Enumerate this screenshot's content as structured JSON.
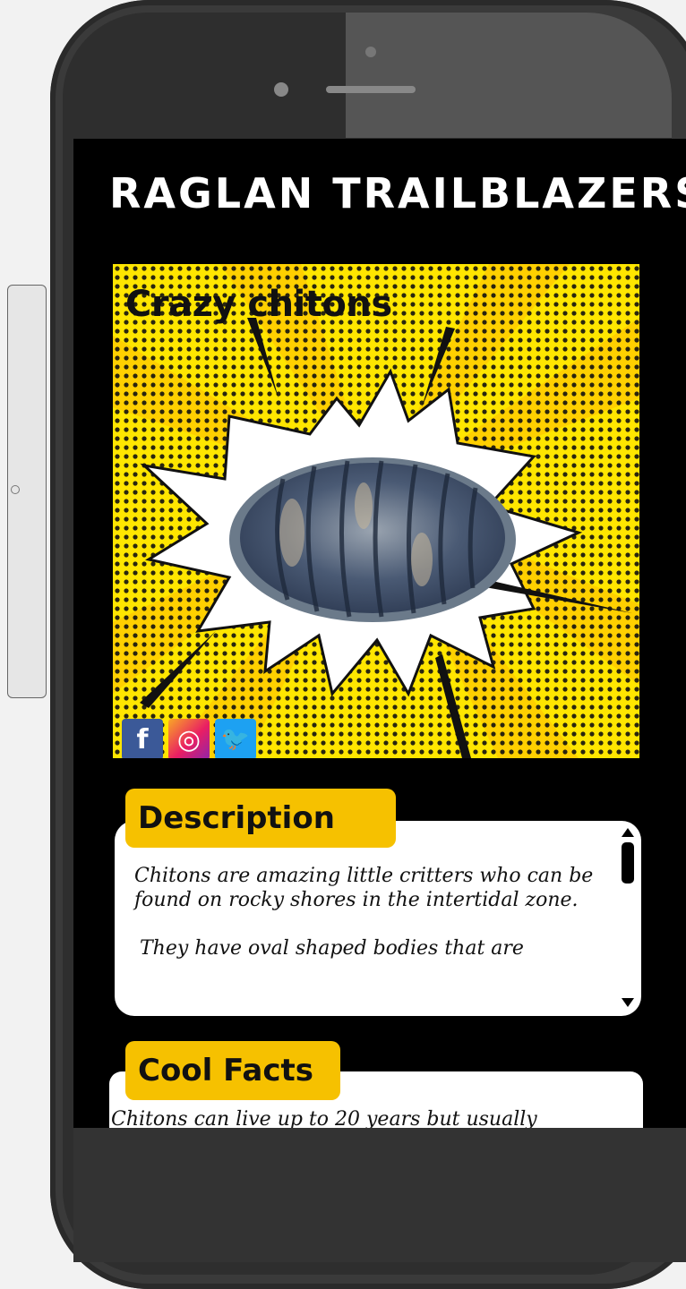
{
  "app": {
    "title": "RAGLAN TRAILBLAZERS"
  },
  "hero": {
    "title": "Crazy chitons",
    "social": {
      "facebook": "f",
      "instagram": "◎",
      "twitter": "🐦"
    }
  },
  "description": {
    "heading": "Description",
    "paragraphs": [
      "Chitons are amazing little critters who can be found on rocky shores in the intertidal zone.",
      "They have oval shaped bodies that are"
    ]
  },
  "facts": {
    "heading": "Cool Facts",
    "text": "Chitons can live up to 20 years but usually"
  },
  "colors": {
    "accent": "#f6c100",
    "poster_background": "#ffe600",
    "screen_background": "#000000"
  },
  "icons": [
    "facebook-icon",
    "instagram-icon",
    "twitter-icon",
    "scroll-up-icon",
    "scroll-down-icon"
  ]
}
